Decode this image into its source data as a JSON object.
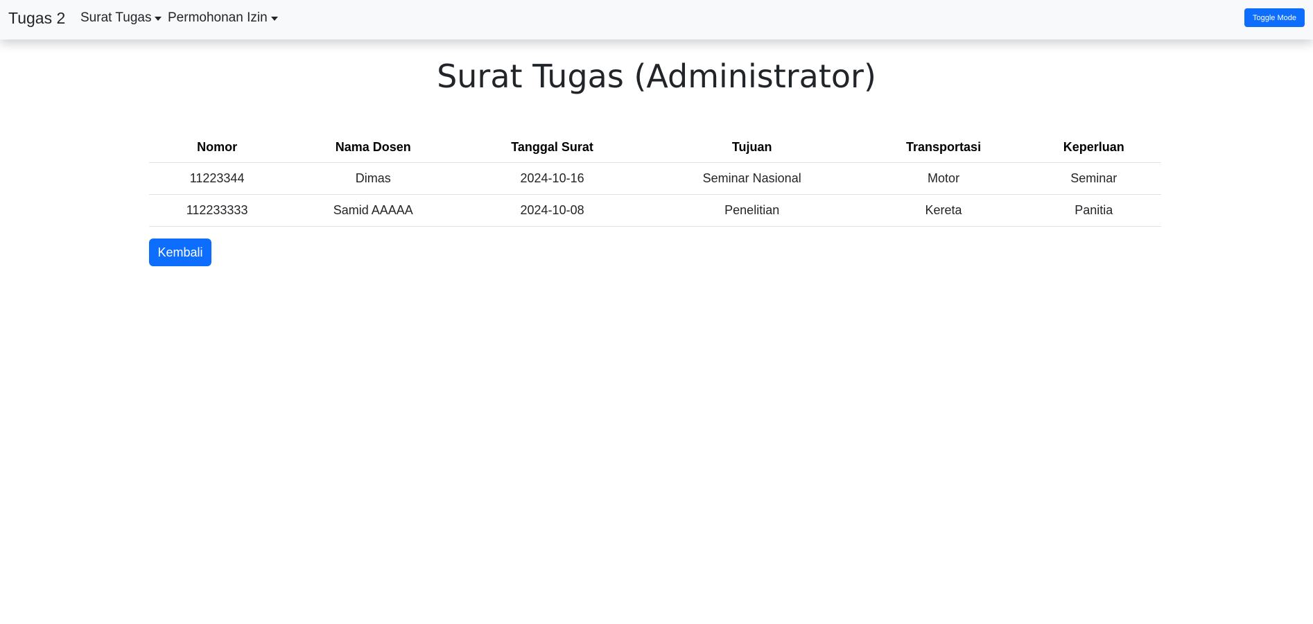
{
  "navbar": {
    "brand": "Tugas 2",
    "menus": [
      {
        "label": "Surat Tugas"
      },
      {
        "label": "Permohonan Izin"
      }
    ],
    "toggle_label": "Toggle Mode"
  },
  "main": {
    "title": "Surat Tugas (Administrator)",
    "table": {
      "headers": [
        "Nomor",
        "Nama Dosen",
        "Tanggal Surat",
        "Tujuan",
        "Transportasi",
        "Keperluan"
      ],
      "rows": [
        [
          "11223344",
          "Dimas",
          "2024-10-16",
          "Seminar Nasional",
          "Motor",
          "Seminar"
        ],
        [
          "112233333",
          "Samid AAAAA",
          "2024-10-08",
          "Penelitian",
          "Kereta",
          "Panitia"
        ]
      ]
    },
    "back_label": "Kembali"
  },
  "colors": {
    "primary": "#0d6efd",
    "navbar_bg": "#f8f9fa",
    "text": "#212529",
    "border": "#dee2e6"
  }
}
